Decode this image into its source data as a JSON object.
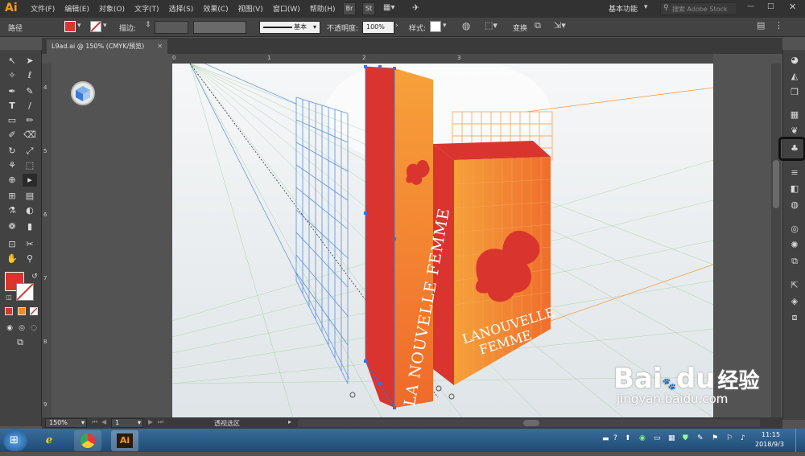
{
  "app": {
    "logo": "Ai",
    "workspace": "基本功能",
    "search_placeholder": "搜索 Adobe Stock"
  },
  "menu": [
    "文件(F)",
    "编辑(E)",
    "对象(O)",
    "文字(T)",
    "选择(S)",
    "效果(C)",
    "视图(V)",
    "窗口(W)",
    "帮助(H)"
  ],
  "menu_icons": {
    "br": "Br",
    "st": "St"
  },
  "control": {
    "path_label": "路径",
    "stroke_label": "描边:",
    "stroke_profile": "基本",
    "opacity_label": "不透明度:",
    "opacity_value": "100%",
    "style_label": "样式:",
    "transform_label": "变换"
  },
  "document": {
    "tab_title": "L9ad.ai @ 150% (CMYK/预览)"
  },
  "ruler": {
    "top_ticks": [
      "0",
      "1",
      "2",
      "3"
    ],
    "left_ticks": [
      "4",
      "5",
      "6",
      "7",
      "8",
      "9"
    ]
  },
  "artwork": {
    "spine_text": "LA NOUVELLE FEMME",
    "front_line1": "LANOUVELLE",
    "front_line2": "FEMME"
  },
  "status": {
    "zoom": "150%",
    "page": "1",
    "tool_name": "透视选区"
  },
  "taskbar": {
    "ai_label": "Ai",
    "time": "11:15",
    "date": "2018/9/3"
  },
  "watermark": {
    "brand": "Bai",
    "brand2": "du",
    "cn": "经验",
    "url": "jingyan.baidu.com"
  },
  "colors": {
    "fill": "#d9352e",
    "orange": "#f08a2a",
    "grid_blue": "#5b8fe0",
    "grid_orange": "#f29a3a",
    "accent": "#f79b1f"
  }
}
